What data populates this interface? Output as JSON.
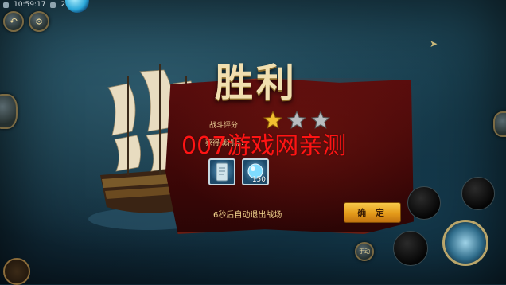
{
  "status": {
    "time": "10:59:17",
    "network": "25m"
  },
  "title": "胜利",
  "rating_label": "战斗评分:",
  "rating": {
    "stars_filled": 1,
    "stars_total": 3
  },
  "rewards_label": "获得战利品:",
  "rewards": [
    {
      "icon": "scroll-icon",
      "count": ""
    },
    {
      "icon": "exp-orb-icon",
      "count": "150"
    }
  ],
  "auto_exit_text": "6秒后自动退出战场",
  "confirm_label": "确 定",
  "watermark": "007游戏网亲测",
  "auto_label": "手动",
  "colors": {
    "panel": "#4a0a0a",
    "button": "#e49b1a",
    "title": "#f1dfb0"
  }
}
